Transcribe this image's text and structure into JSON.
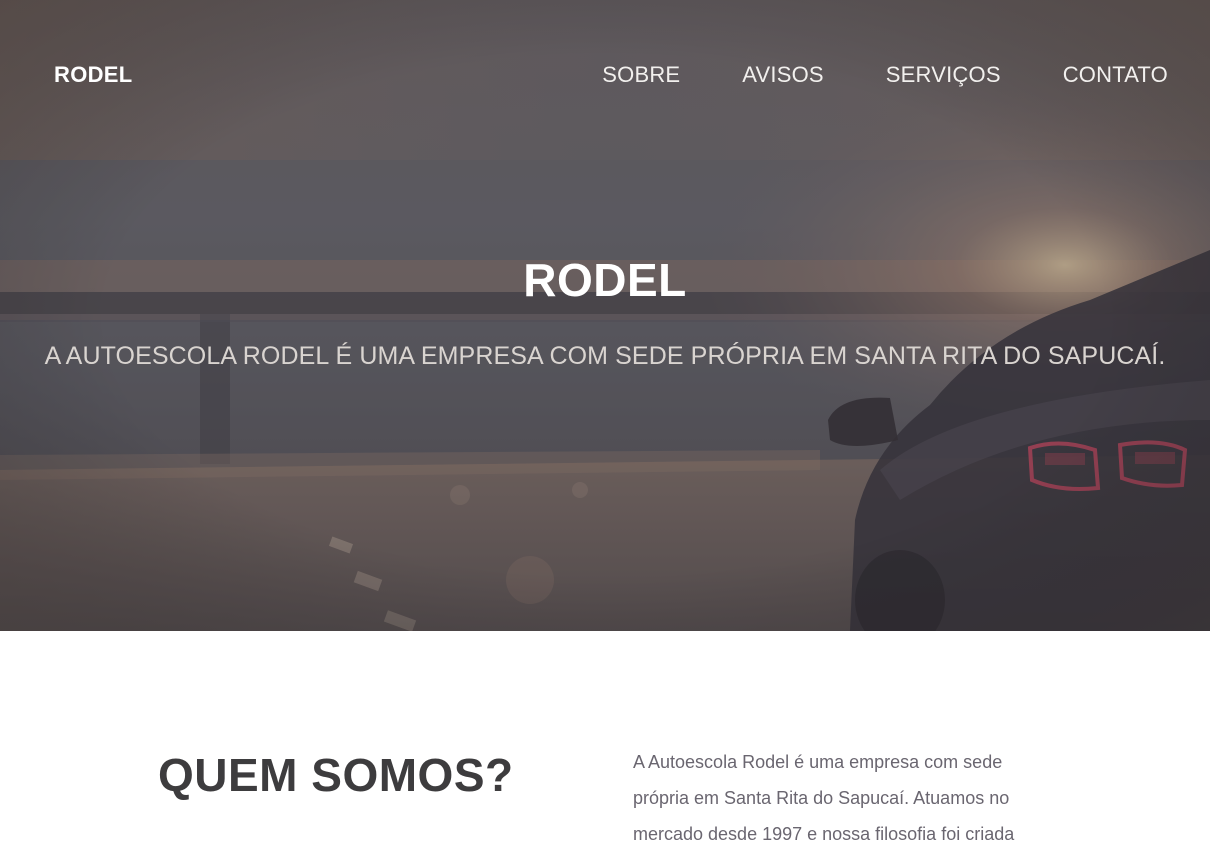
{
  "navbar": {
    "brand": "RODEL",
    "links": [
      "SOBRE",
      "AVISOS",
      "SERVIÇOS",
      "CONTATO"
    ]
  },
  "hero": {
    "title": "RODEL",
    "subtitle": "A AUTOESCOLA RODEL É UMA EMPRESA COM SEDE PRÓPRIA EM SANTA RITA DO SAPUCAÍ.",
    "background_image": "road-car-sunset"
  },
  "about": {
    "heading": "QUEM SOMOS?",
    "text": "A Autoescola Rodel é uma empresa com sede própria em Santa Rita do Sapucaí. Atuamos no mercado desde 1997 e nossa filosofia foi criada"
  },
  "colors": {
    "hero_tint": "#5a585c",
    "heading_dark": "#3d3c3e",
    "body_text": "#6a6670",
    "tail_light": "#d8405a"
  }
}
